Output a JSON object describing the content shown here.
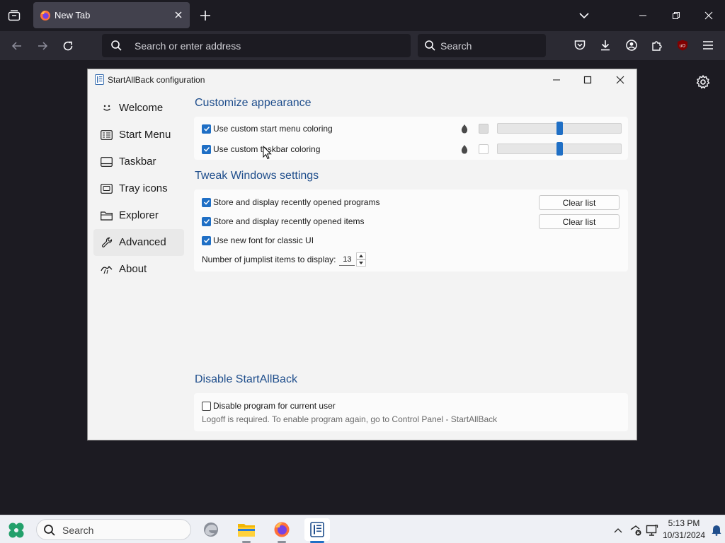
{
  "browser": {
    "tab_title": "New Tab",
    "urlbar_placeholder": "Search or enter address",
    "search_placeholder": "Search"
  },
  "dialog": {
    "title": "StartAllBack configuration",
    "nav": [
      {
        "label": "Welcome",
        "icon": "smiley-icon"
      },
      {
        "label": "Start Menu",
        "icon": "start-menu-icon"
      },
      {
        "label": "Taskbar",
        "icon": "taskbar-icon"
      },
      {
        "label": "Tray icons",
        "icon": "tray-icons-icon"
      },
      {
        "label": "Explorer",
        "icon": "folder-icon"
      },
      {
        "label": "Advanced",
        "icon": "wrench-icon",
        "active": true
      },
      {
        "label": "About",
        "icon": "about-icon"
      }
    ],
    "appearance": {
      "title": "Customize appearance",
      "start_menu_coloring": {
        "label": "Use custom start menu coloring",
        "checked": true,
        "slider": 0.5
      },
      "taskbar_coloring": {
        "label": "Use custom taskbar coloring",
        "checked": true,
        "slider": 0.5
      }
    },
    "tweak": {
      "title": "Tweak Windows settings",
      "recent_programs": {
        "label": "Store and display recently opened programs",
        "checked": true
      },
      "recent_items": {
        "label": "Store and display recently opened items",
        "checked": true
      },
      "new_font": {
        "label": "Use new font for classic UI",
        "checked": true
      },
      "jumplist_label": "Number of jumplist items to display:",
      "jumplist_value": "13",
      "clear_list_label": "Clear list"
    },
    "disable": {
      "title": "Disable StartAllBack",
      "checkbox_label": "Disable program for current user",
      "checked": false,
      "hint": "Logoff is required. To enable program again, go to Control Panel - StartAllBack"
    }
  },
  "taskbar": {
    "search_placeholder": "Search",
    "time": "5:13 PM",
    "date": "10/31/2024"
  },
  "colors": {
    "accent": "#1f6fc5",
    "section_title": "#1f4e8c",
    "browser_bg": "#1c1b22"
  }
}
